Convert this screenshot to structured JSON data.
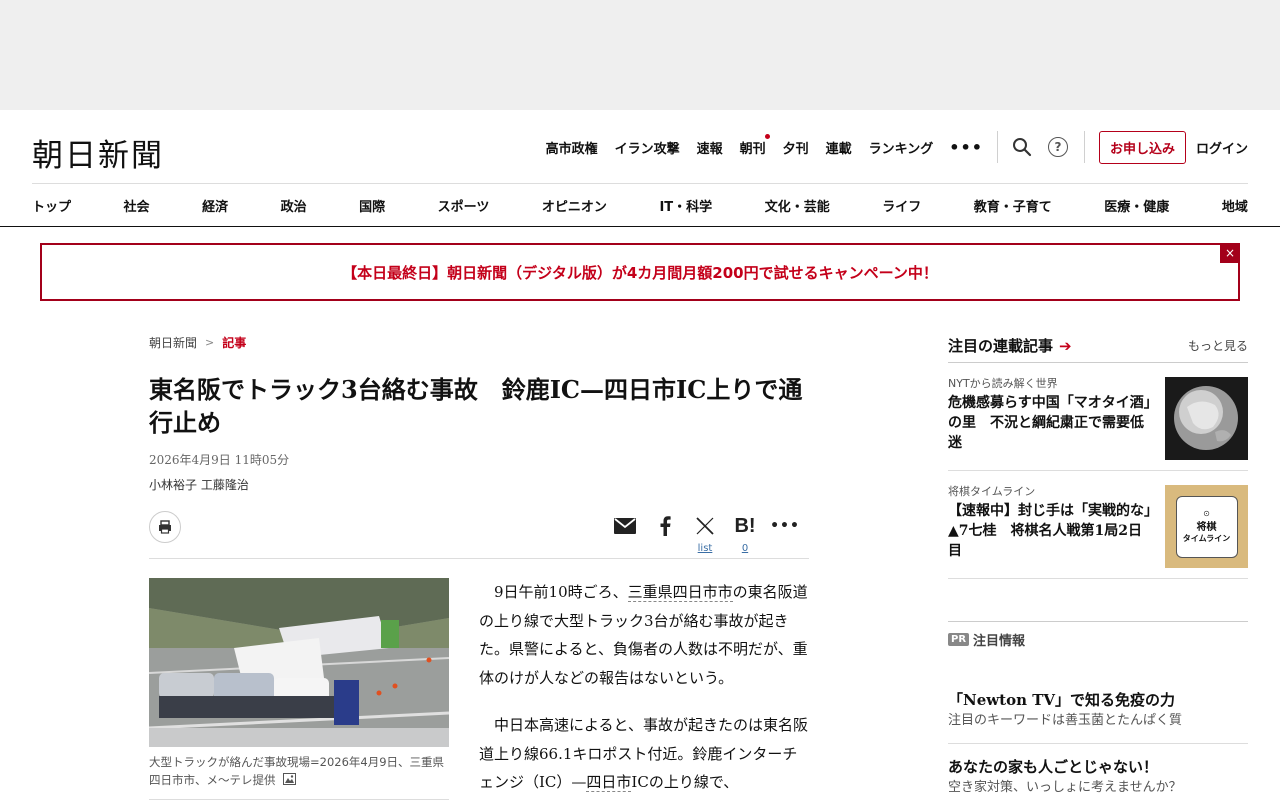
{
  "brand": {
    "logo": "朝日新聞",
    "accent": "#c4001a"
  },
  "topnav": {
    "items": [
      "高市政権",
      "イラン攻撃",
      "速報",
      "朝刊",
      "夕刊",
      "連載",
      "ランキング"
    ],
    "more": "•••",
    "subscribe": "お申し込み",
    "login": "ログイン",
    "help": "?"
  },
  "categories": [
    "トップ",
    "社会",
    "経済",
    "政治",
    "国際",
    "スポーツ",
    "オピニオン",
    "IT・科学",
    "文化・芸能",
    "ライフ",
    "教育・子育て",
    "医療・健康",
    "地域"
  ],
  "promo": {
    "text": "【本日最終日】朝日新聞（デジタル版）が4カ月間月額200円で試せるキャンペーン中！",
    "close": "×"
  },
  "article": {
    "breadcrumb": {
      "home": "朝日新聞",
      "current": "記事",
      "sep": ">"
    },
    "headline": "東名阪でトラック3台絡む事故　鈴鹿IC—四日市IC上りで通行止め",
    "date": "2026年4月9日 11時05分",
    "byline": "小林裕子 工藤隆治",
    "share": {
      "x_label": "list",
      "hatena_count": "0"
    },
    "photo_caption": "大型トラックが絡んだ事故現場=2026年4月9日、三重県四日市市、メ～テレ提供",
    "p1": {
      "a": "9日午前10時ごろ、",
      "link": "三重県四日市市",
      "b": "の東名阪道の上り線で大型トラック3台が絡む事故が起きた。県警によると、負傷者の人数は不明だが、重体のけが人などの報告はないという。"
    },
    "p2": {
      "a": "中日本高速によると、事故が起きたのは東名阪道上り線66.1キロポスト付近。鈴鹿インターチェンジ（IC）—",
      "link": "四日市",
      "b": "ICの上り線で、"
    }
  },
  "sidebar": {
    "title": "注目の連載記事",
    "more": "もっと見る",
    "items": [
      {
        "kicker": "NYTから読み解く世界",
        "title": "危機感募らす中国「マオタイ酒」の里　不況と綱紀粛正で需要低迷",
        "thumb_icon": "globe-icon"
      },
      {
        "kicker": "将棋タイムライン",
        "title": "【速報中】封じ手は「実戦的な」▲7七桂　将棋名人戦第1局2日目",
        "thumb_icon": "shogi-timeline-icon",
        "thumb_text_1": "将棋",
        "thumb_text_2": "タイムライン"
      }
    ]
  },
  "pr": {
    "badge": "PR",
    "label": "注目情報",
    "items": [
      {
        "title": "「Newton TV」で知る免疫の力",
        "sub": "注目のキーワードは善玉菌とたんぱく質"
      },
      {
        "title": "あなたの家も人ごとじゃない！",
        "sub": "空き家対策、いっしょに考えませんか？"
      }
    ]
  }
}
